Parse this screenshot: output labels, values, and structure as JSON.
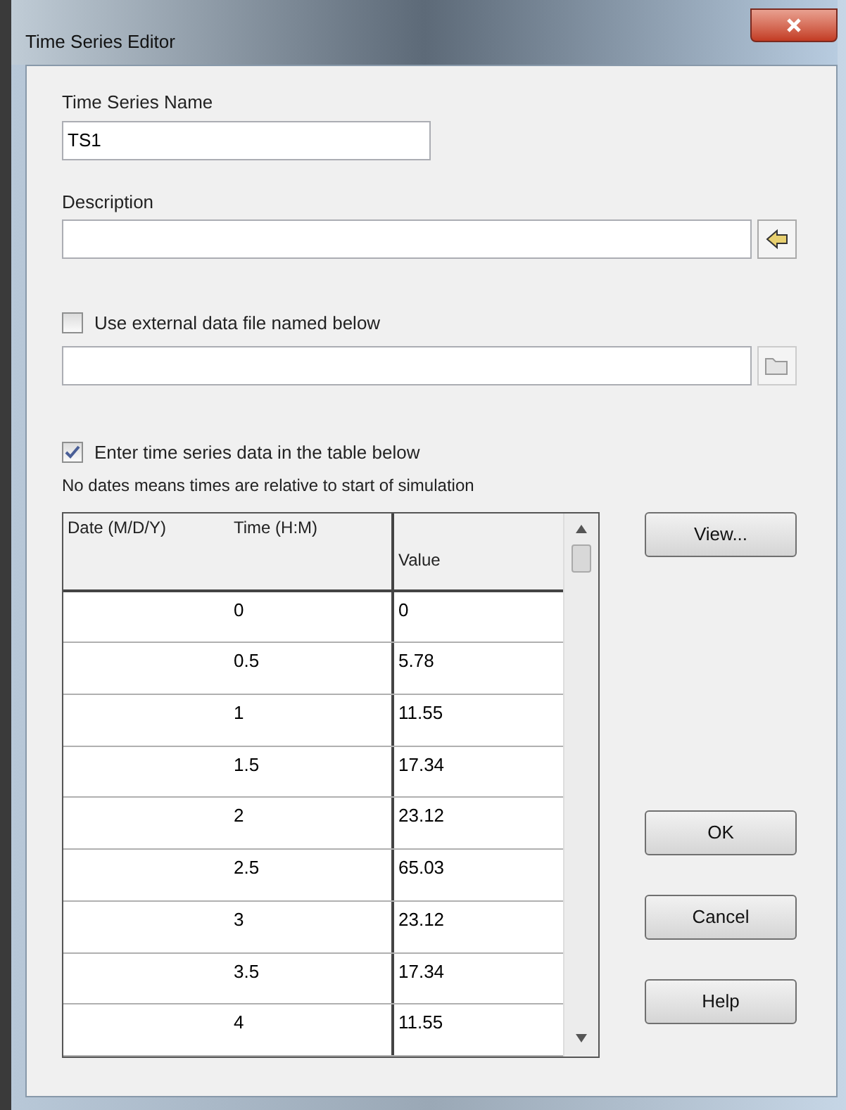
{
  "window": {
    "title": "Time Series Editor"
  },
  "name_field": {
    "label": "Time Series Name",
    "value": "TS1"
  },
  "description_field": {
    "label": "Description"
  },
  "external_file": {
    "label": "Use external data file named below",
    "checked": false
  },
  "table_option": {
    "label": "Enter time series data in the table below",
    "checked": true
  },
  "note": "No dates means times are relative to start of simulation",
  "table": {
    "columns": [
      "Date (M/D/Y)",
      "Time (H:M)",
      "Value"
    ],
    "rows": [
      {
        "time": "0",
        "value": "0"
      },
      {
        "time": "0.5",
        "value": "5.78"
      },
      {
        "time": "1",
        "value": "11.55"
      },
      {
        "time": "1.5",
        "value": "17.34"
      },
      {
        "time": "2",
        "value": "23.12"
      },
      {
        "time": "2.5",
        "value": "65.03"
      },
      {
        "time": "3",
        "value": "23.12"
      },
      {
        "time": "3.5",
        "value": "17.34"
      },
      {
        "time": "4",
        "value": "11.55"
      }
    ]
  },
  "buttons": {
    "view": "View...",
    "ok": "OK",
    "cancel": "Cancel",
    "help": "Help"
  }
}
